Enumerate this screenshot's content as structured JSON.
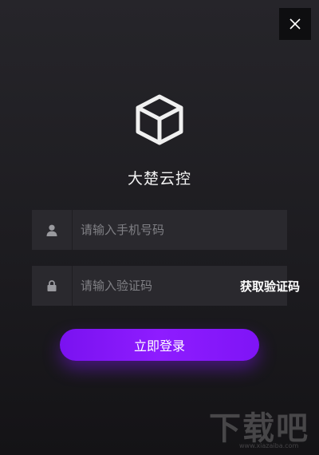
{
  "window": {
    "close_icon": "close-icon"
  },
  "branding": {
    "logo_icon": "cube-icon",
    "app_name": "大楚云控"
  },
  "form": {
    "phone": {
      "icon": "user-icon",
      "placeholder": "请输入手机号码",
      "value": ""
    },
    "code": {
      "icon": "lock-icon",
      "placeholder": "请输入验证码",
      "value": "",
      "get_code_label": "获取验证码"
    },
    "login_label": "立即登录"
  },
  "watermark": {
    "text": "下载吧",
    "url": "www.xiazaiba.com"
  },
  "colors": {
    "accent": "#8a1aff",
    "background": "#1c1b1f",
    "field_bg": "#2a292e"
  }
}
